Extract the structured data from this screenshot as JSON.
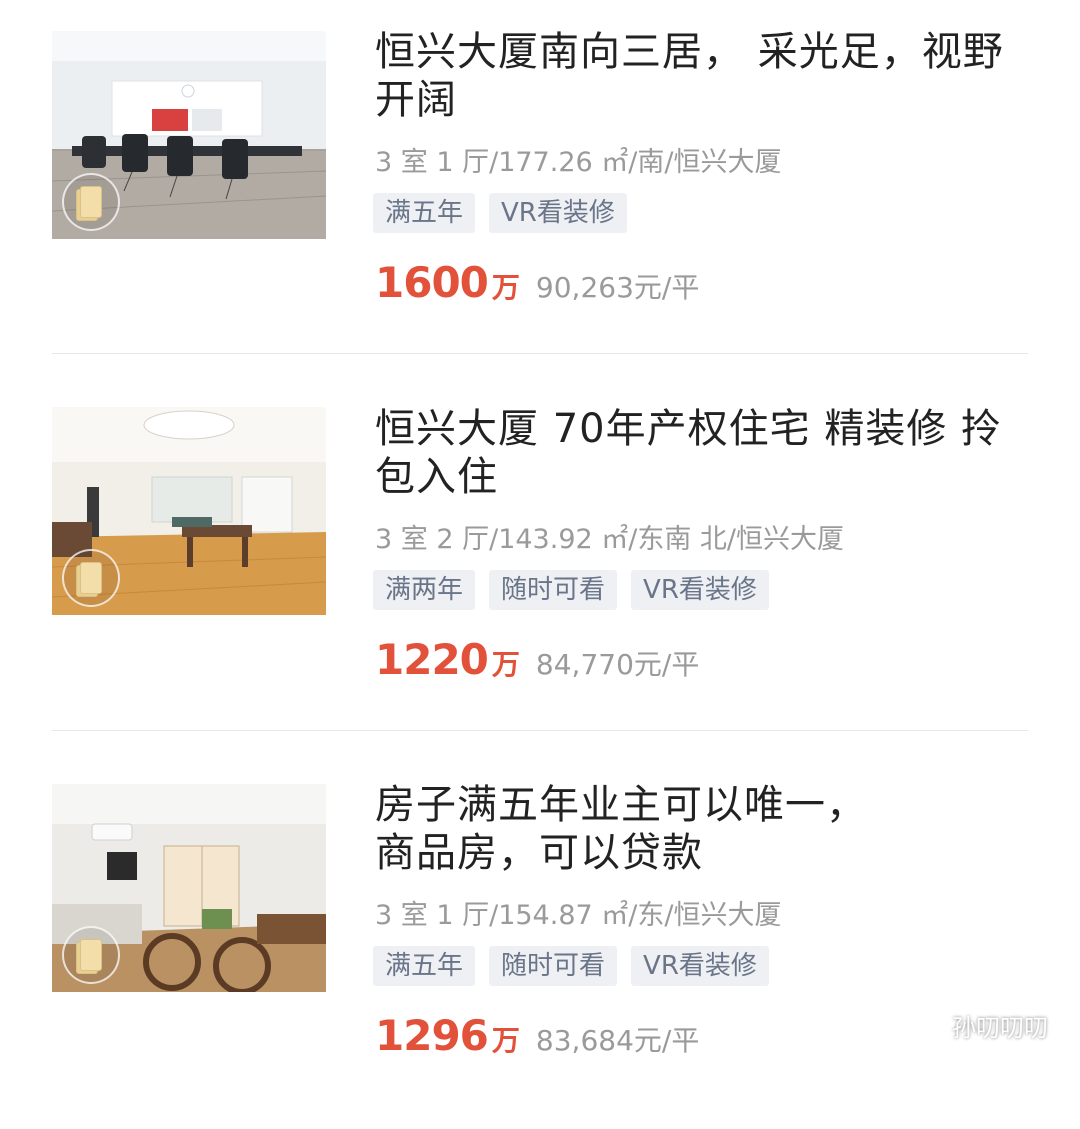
{
  "listings": [
    {
      "title": "恒兴大厦南向三居， 采光足，视野开阔",
      "meta": "3 室 1 厅/177.26 ㎡/南/恒兴大厦",
      "tags": [
        "满五年",
        "VR看装修"
      ],
      "price": "1600",
      "price_unit": "万",
      "unit_price": "90,263元/平"
    },
    {
      "title": "恒兴大厦 70年产权住宅 精装修 拎包入住",
      "meta": "3 室 2 厅/143.92 ㎡/东南 北/恒兴大厦",
      "tags": [
        "满两年",
        "随时可看",
        "VR看装修"
      ],
      "price": "1220",
      "price_unit": "万",
      "unit_price": "84,770元/平"
    },
    {
      "title": "房子满五年业主可以唯一，商品房，可以贷款",
      "meta": "3 室 1 厅/154.87 ㎡/东/恒兴大厦",
      "tags": [
        "满五年",
        "随时可看",
        "VR看装修"
      ],
      "price": "1296",
      "price_unit": "万",
      "unit_price": "83,684元/平"
    }
  ],
  "watermark": {
    "text": "孙叨叨叨",
    "icon": "wechat-icon"
  },
  "colors": {
    "price": "#e2513a",
    "tag_bg": "#eef0f4",
    "tag_text": "#6a7589",
    "meta_text": "#9a9a9a",
    "title_text": "#222222"
  }
}
